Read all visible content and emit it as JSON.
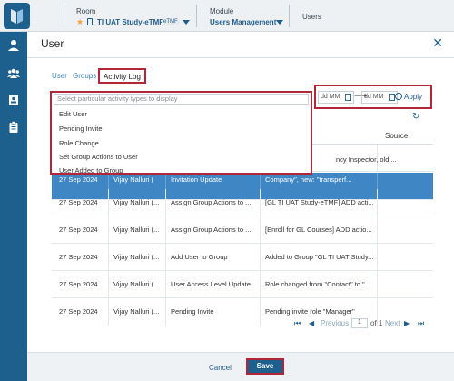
{
  "topbar": {
    "room_label": "Room",
    "room_value": "TI UAT Study-eTMF",
    "room_badge": "eTMF",
    "module_label": "Module",
    "module_value": "Users Management",
    "page_label": "Users"
  },
  "modal": {
    "title": "User",
    "close": "✕",
    "tabs": [
      "User",
      "Groups",
      "Activity Log"
    ],
    "active_tab": "Activity Log"
  },
  "filters": {
    "search_placeholder": "Select particular activity types to display",
    "options": [
      "Edit User",
      "Pending Invite",
      "Role Change",
      "Set Group Actions to User",
      "User Added to Group"
    ],
    "date_from": "dd MM",
    "date_to": "dd MM",
    "apply_label": "Apply"
  },
  "table": {
    "source_header": "Source",
    "partial_text": "ncy Inspector, old:...",
    "selected_partial": [
      "27 Sep 2024",
      "Vijay Nalluri (",
      "Invitation Update",
      "Company\", new: \"transperf..."
    ],
    "rows": [
      [
        "27 Sep 2024",
        "Vijay Nalluri (...",
        "Assign Group Actions to ...",
        "[GL TI UAT Study-eTMF] ADD acti..."
      ],
      [
        "27 Sep 2024",
        "Vijay Nalluri (...",
        "Assign Group Actions to ...",
        "[Enroll for GL Courses] ADD actio..."
      ],
      [
        "27 Sep 2024",
        "Vijay Nalluri (...",
        "Add User to Group",
        "Added to Group \"GL TI UAT Study..."
      ],
      [
        "27 Sep 2024",
        "Vijay Nalluri (...",
        "User Access Level Update",
        "Role changed from \"Contact\" to \"..."
      ],
      [
        "27 Sep 2024",
        "Vijay Nalluri (...",
        "Pending Invite",
        "Pending invite role \"Manager\""
      ]
    ]
  },
  "pager": {
    "previous": "Previous",
    "page": "1",
    "of_label": "of 1",
    "next": "Next"
  },
  "footer": {
    "cancel": "Cancel",
    "save": "Save"
  }
}
